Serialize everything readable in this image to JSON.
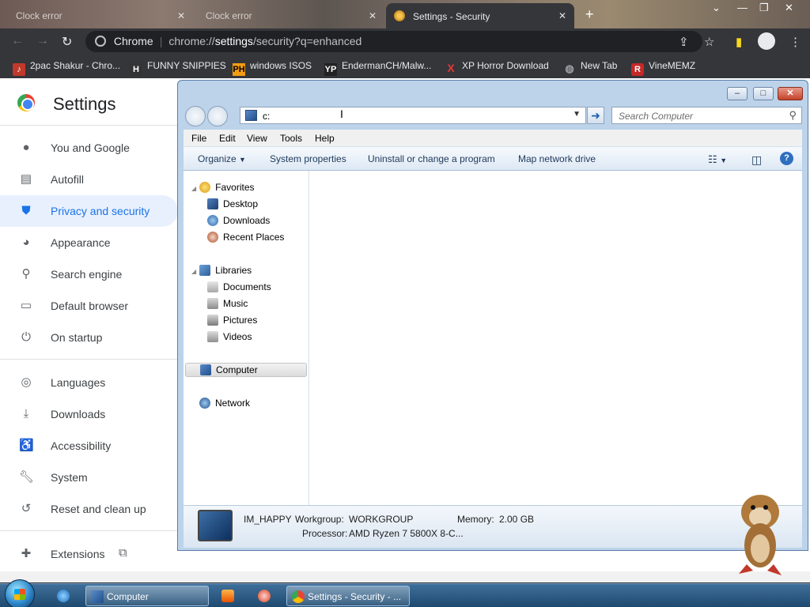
{
  "chrome": {
    "tabs": [
      {
        "title": "Clock error"
      },
      {
        "title": "Clock error"
      },
      {
        "title": "Settings - Security"
      }
    ],
    "omnibox": {
      "site": "Chrome",
      "url_prefix": "chrome://",
      "url_host": "settings",
      "url_rest": "/security?q=enhanced"
    },
    "bookmarks": [
      {
        "label": "2pac Shakur - Chro...",
        "icon": "music-icon"
      },
      {
        "label": "FUNNY SNIPPIES",
        "icon": "H"
      },
      {
        "label": "windows ISOS",
        "icon": "PH"
      },
      {
        "label": "EndermanCH/Malw...",
        "icon": "YP"
      },
      {
        "label": "XP Horror Download",
        "icon": "X"
      },
      {
        "label": "New Tab",
        "icon": "globe-icon"
      },
      {
        "label": "VineMEMZ",
        "icon": "R"
      }
    ]
  },
  "settings": {
    "title": "Settings",
    "nav": [
      {
        "label": "You and Google",
        "icon": "person-icon"
      },
      {
        "label": "Autofill",
        "icon": "clipboard-icon"
      },
      {
        "label": "Privacy and security",
        "icon": "shield-icon",
        "selected": true
      },
      {
        "label": "Appearance",
        "icon": "palette-icon"
      },
      {
        "label": "Search engine",
        "icon": "search-icon"
      },
      {
        "label": "Default browser",
        "icon": "browser-icon"
      },
      {
        "label": "On startup",
        "icon": "power-icon"
      },
      {
        "label": "Languages",
        "icon": "globe-icon"
      },
      {
        "label": "Downloads",
        "icon": "download-icon"
      },
      {
        "label": "Accessibility",
        "icon": "accessibility-icon"
      },
      {
        "label": "System",
        "icon": "wrench-icon"
      },
      {
        "label": "Reset and clean up",
        "icon": "restore-icon"
      },
      {
        "label": "Extensions",
        "icon": "puzzle-icon"
      }
    ]
  },
  "explorer": {
    "address_value": "c:",
    "search_placeholder": "Search Computer",
    "menu": [
      "File",
      "Edit",
      "View",
      "Tools",
      "Help"
    ],
    "commands": [
      "Organize",
      "System properties",
      "Uninstall or change a program",
      "Map network drive"
    ],
    "tree": {
      "favorites": "Favorites",
      "desktop": "Desktop",
      "downloads": "Downloads",
      "recent": "Recent Places",
      "libraries": "Libraries",
      "documents": "Documents",
      "music": "Music",
      "pictures": "Pictures",
      "videos": "Videos",
      "computer": "Computer",
      "network": "Network"
    },
    "details": {
      "name": "IM_HAPPY",
      "workgroup_label": "Workgroup:",
      "workgroup": "WORKGROUP",
      "memory_label": "Memory:",
      "memory": "2.00 GB",
      "processor_label": "Processor:",
      "processor": "AMD Ryzen 7 5800X 8-C..."
    }
  },
  "taskbar": {
    "items": [
      {
        "label": "Computer"
      },
      {
        "label": "Settings - Security - ..."
      }
    ]
  }
}
